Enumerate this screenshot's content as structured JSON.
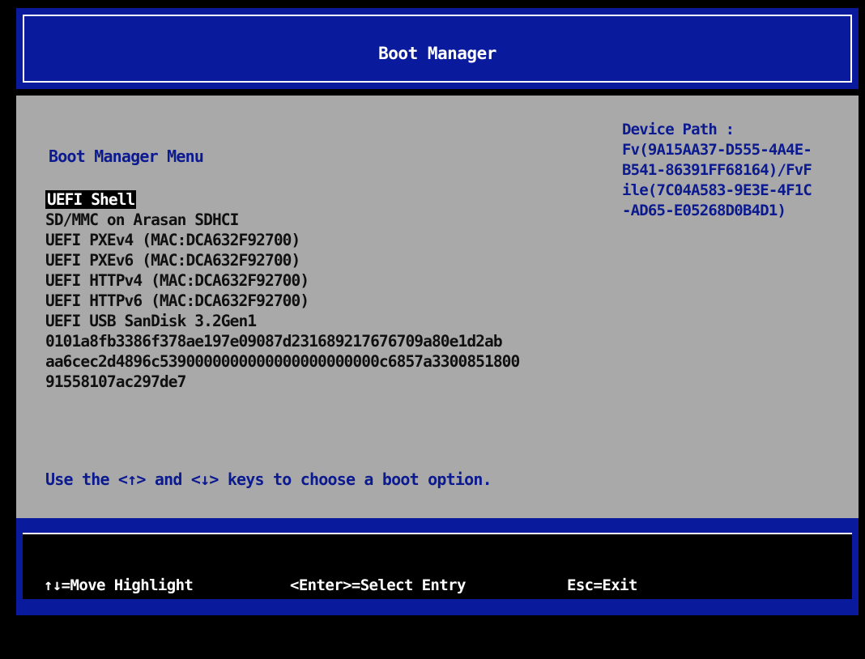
{
  "title": "Boot Manager",
  "menu": {
    "heading": "Boot Manager Menu",
    "options": [
      "UEFI Shell",
      "SD/MMC on Arasan SDHCI",
      "UEFI PXEv4 (MAC:DCA632F92700)",
      "UEFI PXEv6 (MAC:DCA632F92700)",
      "UEFI HTTPv4 (MAC:DCA632F92700)",
      "UEFI HTTPv6 (MAC:DCA632F92700)",
      "UEFI USB SanDisk 3.2Gen1",
      "0101a8fb3386f378ae197e09087d231689217676709a80e1d2ab",
      "aa6cec2d4896c5390000000000000000000000c6857a3300851800",
      "91558107ac297de7"
    ],
    "selected_index": 0,
    "hint": "Use the <↑> and <↓> keys to choose a boot option."
  },
  "device_path": {
    "label": "Device Path :",
    "lines": [
      "Fv(9A15AA37-D555-4A4E-",
      "B541-86391FF68164)/FvF",
      "ile(7C04A583-9E3E-4F1C",
      "-AD65-E05268D0B4D1)"
    ]
  },
  "footer": {
    "move": "↑↓=Move Highlight",
    "select": "<Enter>=Select Entry",
    "exit": "Esc=Exit"
  },
  "colors": {
    "bar_blue": "#0a1a9c",
    "panel_gray": "#a9a9a9",
    "text_blue": "#0c1a90",
    "highlight_bg": "#000000"
  }
}
